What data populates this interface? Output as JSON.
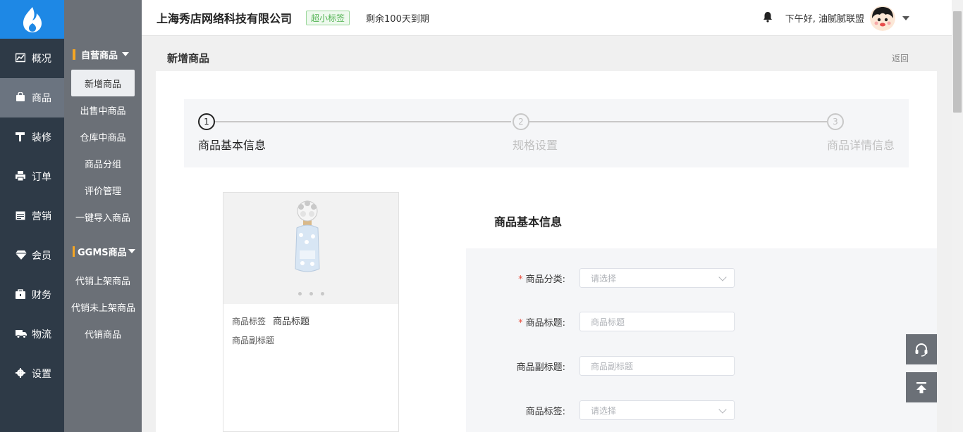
{
  "header": {
    "company": "上海秀店网络科技有限公司",
    "tag": "超小标签",
    "expire": "剩余100天到期",
    "greeting": "下午好, 油腻腻联盟"
  },
  "main_nav": [
    {
      "label": "概况",
      "icon": "chart-icon"
    },
    {
      "label": "商品",
      "icon": "bag-icon"
    },
    {
      "label": "装修",
      "icon": "paint-roller-icon"
    },
    {
      "label": "订单",
      "icon": "print-icon"
    },
    {
      "label": "营销",
      "icon": "calendar-icon"
    },
    {
      "label": "会员",
      "icon": "diamond-icon"
    },
    {
      "label": "财务",
      "icon": "wallet-icon"
    },
    {
      "label": "物流",
      "icon": "truck-icon"
    },
    {
      "label": "设置",
      "icon": "gear-icon"
    }
  ],
  "sub_nav": {
    "group1": "自营商品",
    "group1_items": [
      "新增商品",
      "出售中商品",
      "仓库中商品",
      "商品分组",
      "评价管理",
      "一键导入商品"
    ],
    "group2": "GGMS商品",
    "group2_items": [
      "代销上架商品",
      "代销未上架商品",
      "代销商品"
    ]
  },
  "page": {
    "title": "新增商品",
    "back": "返回"
  },
  "steps": [
    {
      "num": "1",
      "label": "商品基本信息"
    },
    {
      "num": "2",
      "label": "规格设置"
    },
    {
      "num": "3",
      "label": "商品详情信息"
    }
  ],
  "preview": {
    "tag": "商品标签",
    "title": "商品标题",
    "subtitle": "商品副标题"
  },
  "form": {
    "heading": "商品基本信息",
    "fields": [
      {
        "label": "商品分类:",
        "required": "*",
        "placeholder": "请选择",
        "type": "select"
      },
      {
        "label": "商品标题:",
        "required": "*",
        "placeholder": "商品标题",
        "type": "input"
      },
      {
        "label": "商品副标题:",
        "required": "",
        "placeholder": "商品副标题",
        "type": "input"
      },
      {
        "label": "商品标签:",
        "required": "",
        "placeholder": "请选择",
        "type": "select"
      }
    ]
  },
  "colors": {
    "logo_bg": "#1e88e5",
    "sidebar_bg": "#2e3a47",
    "subnav_bg": "#6b7077",
    "accent_bar": "#f5a623"
  }
}
